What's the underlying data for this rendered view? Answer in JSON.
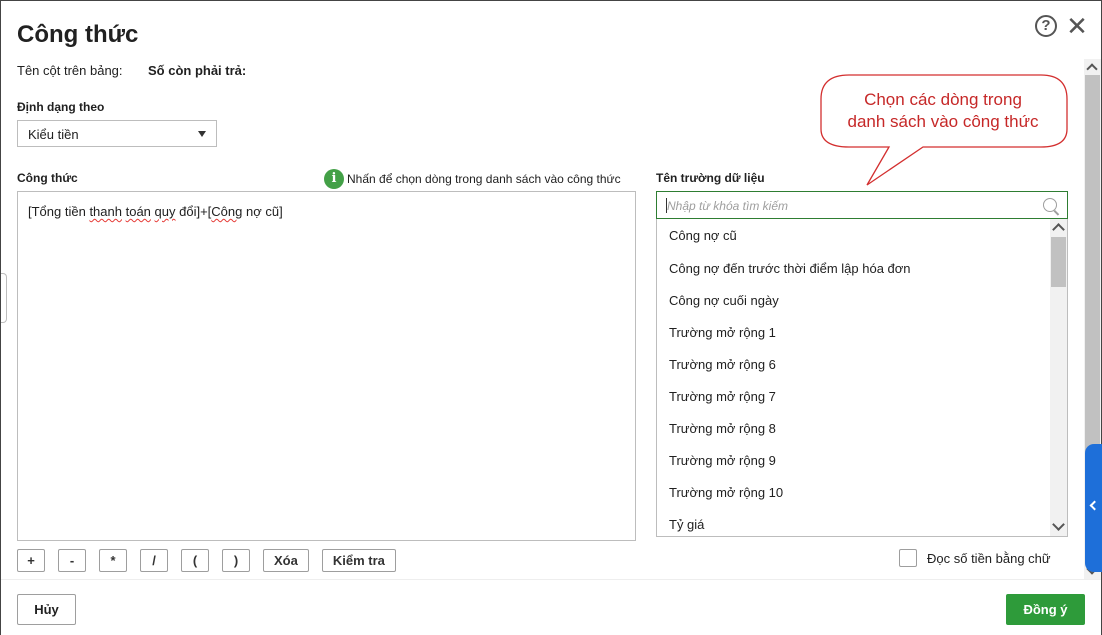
{
  "dialog": {
    "title": "Công thức",
    "help_icon": "question-circle-icon",
    "close_icon": "close-icon"
  },
  "column": {
    "label": "Tên cột trên bảng:",
    "value": "Số còn phải trả:"
  },
  "format": {
    "label": "Định dạng theo",
    "selected": "Kiểu tiền"
  },
  "formula": {
    "label": "Công thức",
    "hint": "Nhấn để chọn dòng trong danh sách vào công thức",
    "hint_icon": "i",
    "text_parts": [
      "[Tổng tiền ",
      "thanh",
      " ",
      "toán",
      " ",
      "quy",
      " đổi]+[",
      "Công",
      " nợ cũ]"
    ]
  },
  "operators": [
    "+",
    "-",
    "*",
    "/",
    "(",
    ")"
  ],
  "actions": {
    "delete_label": "Xóa",
    "check_label": "Kiểm tra"
  },
  "fields": {
    "label": "Tên trường dữ liệu",
    "search_placeholder": "Nhập từ khóa tìm kiếm",
    "items": [
      "Công nợ cũ",
      "Công nợ đến trước thời điểm lập hóa đơn",
      "Công nợ cuối ngày",
      "Trường mở rộng 1",
      "Trường mở rộng 6",
      "Trường mở rộng 7",
      "Trường mở rộng 8",
      "Trường mở rộng 9",
      "Trường mở rộng 10",
      "Tỷ giá"
    ]
  },
  "read_amount": {
    "label": "Đọc số tiền bằng chữ",
    "checked": false
  },
  "footer": {
    "cancel_label": "Hủy",
    "ok_label": "Đồng ý"
  },
  "annotation": {
    "line1": "Chọn các dòng trong",
    "line2": "danh sách vào công thức",
    "color": "#c62828"
  },
  "colors": {
    "accent": "#2e9b3a",
    "info": "#43a047",
    "side_tab": "#1e6fd9"
  }
}
